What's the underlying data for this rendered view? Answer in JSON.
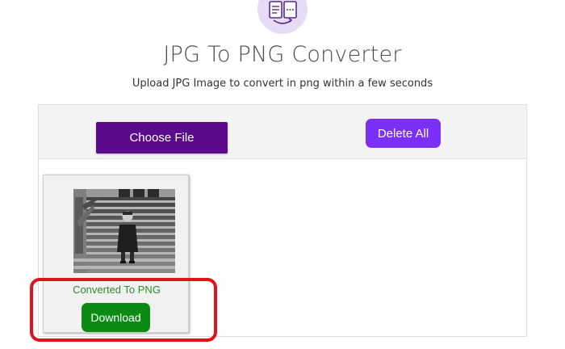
{
  "header": {
    "logo_icon": "file-convert-icon",
    "title": "JPG To PNG Converter",
    "subtitle": "Upload JPG Image to convert in png within a few seconds"
  },
  "toolbar": {
    "choose_file_label": "Choose File",
    "delete_all_label": "Delete All"
  },
  "file_card": {
    "thumbnail": "converted-image-thumbnail",
    "status": "Converted To PNG",
    "download_label": "Download"
  },
  "colors": {
    "choose_button": "#5b0a8e",
    "delete_button": "#7b2ff7",
    "download_button": "#0b8a14",
    "status_text": "#2e8b2e",
    "highlight": "#e0121b",
    "logo_bg": "#e6dcf5"
  }
}
